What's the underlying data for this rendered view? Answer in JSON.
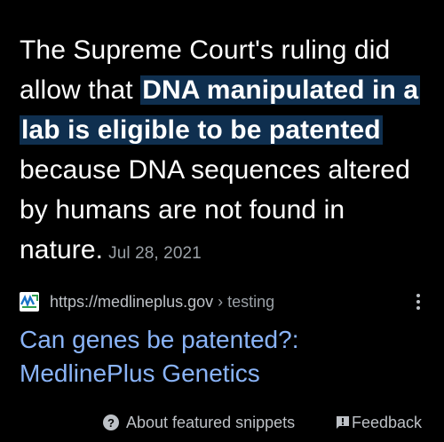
{
  "snippet": {
    "text_before": "The Supreme Court's ruling did allow that ",
    "highlight": "DNA manipulated in a lab is eligible to be patented",
    "text_after": " because DNA sequences altered by humans are not found in nature.",
    "date": "Jul 28, 2021"
  },
  "source": {
    "favicon_icon": "medlineplus-icon",
    "url": "https://medlineplus.gov",
    "breadcrumb": " › testing",
    "more_icon": "more-vert-icon"
  },
  "result": {
    "title_line1": "Can genes be patented?:",
    "title_line2": "MedlinePlus Genetics"
  },
  "footer": {
    "about_icon": "help-circle-icon",
    "about_label": "About featured snippets",
    "feedback_icon": "feedback-icon",
    "feedback_label": "Feedback"
  },
  "colors": {
    "background": "#000000",
    "text": "#ffffff",
    "highlight_bg": "#0f2f4f",
    "link": "#8ab4f8",
    "muted": "#9aa0a6"
  }
}
